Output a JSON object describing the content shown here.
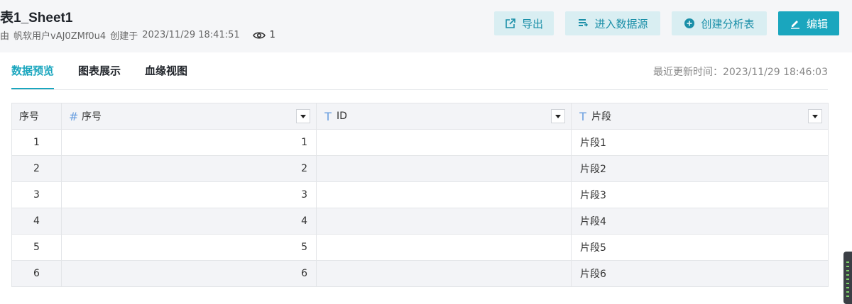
{
  "header": {
    "title": "表1_Sheet1",
    "meta_by": "由",
    "meta_user": "帆软用户vAJ0ZMf0u4",
    "meta_created": "创建于",
    "meta_time": "2023/11/29 18:41:51",
    "view_count": "1",
    "buttons": {
      "export": "导出",
      "enter_datasource": "进入数据源",
      "create_analysis": "创建分析表",
      "edit": "编辑"
    }
  },
  "tabs": [
    {
      "label": "数据预览",
      "active": true
    },
    {
      "label": "图表展示",
      "active": false
    },
    {
      "label": "血缘视图",
      "active": false
    }
  ],
  "update_time": "最近更新时间：2023/11/29 18:46:03",
  "table": {
    "columns": [
      {
        "label": "序号",
        "type": ""
      },
      {
        "label": "序号",
        "type": "#"
      },
      {
        "label": "ID",
        "type": "T"
      },
      {
        "label": "片段",
        "type": "T"
      }
    ],
    "rows": [
      [
        "1",
        "1",
        "",
        "片段1"
      ],
      [
        "2",
        "2",
        "",
        "片段2"
      ],
      [
        "3",
        "3",
        "",
        "片段3"
      ],
      [
        "4",
        "4",
        "",
        "片段4"
      ],
      [
        "5",
        "5",
        "",
        "片段5"
      ],
      [
        "6",
        "6",
        "",
        "片段6"
      ]
    ]
  },
  "colors": {
    "accent": "#1aa6be",
    "button_bg": "#d9eef2",
    "type_icon": "#6a9fe0"
  },
  "icons": {
    "export": "export-icon",
    "enter_datasource": "datasource-icon",
    "create_analysis": "plus-circle-icon",
    "edit": "pencil-icon",
    "views": "eye-icon",
    "dropdown": "caret-down-icon"
  }
}
